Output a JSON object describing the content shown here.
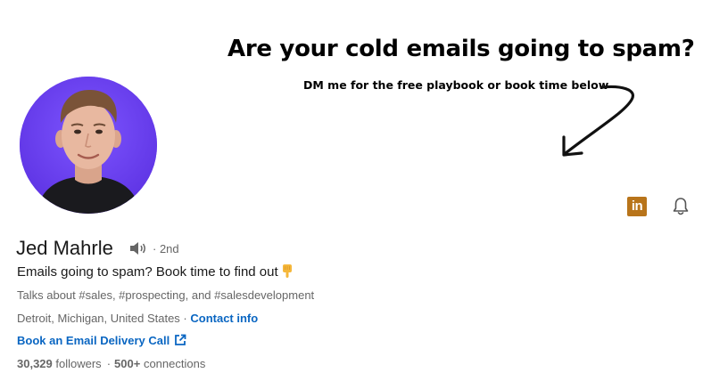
{
  "banner": {
    "headline": "Are your cold emails going to spam?",
    "subtext": "DM me for the free playbook or book time below"
  },
  "profile": {
    "name": "Jed Mahrle",
    "connection_degree": "· 2nd",
    "headline": "Emails going to spam? Book time to find out",
    "talks_about": "Talks about #sales, #prospecting, and #salesdevelopment",
    "location": "Detroit, Michigan, United States",
    "location_separator": " · ",
    "contact_info_label": "Contact info",
    "custom_link_label": "Book an Email Delivery Call",
    "followers_count": "30,329",
    "followers_label": "followers",
    "connections_count": "500+",
    "connections_label": "connections"
  },
  "icons": {
    "linkedin_badge": "in",
    "bell": "bell-icon",
    "speaker": "speaker-icon",
    "external_link": "external-link-icon",
    "emoji": "pointing-down-hand"
  },
  "colors": {
    "link": "#0a66c2",
    "avatar_bg": "#6a3df0",
    "linkedin_badge": "#b8741a"
  }
}
